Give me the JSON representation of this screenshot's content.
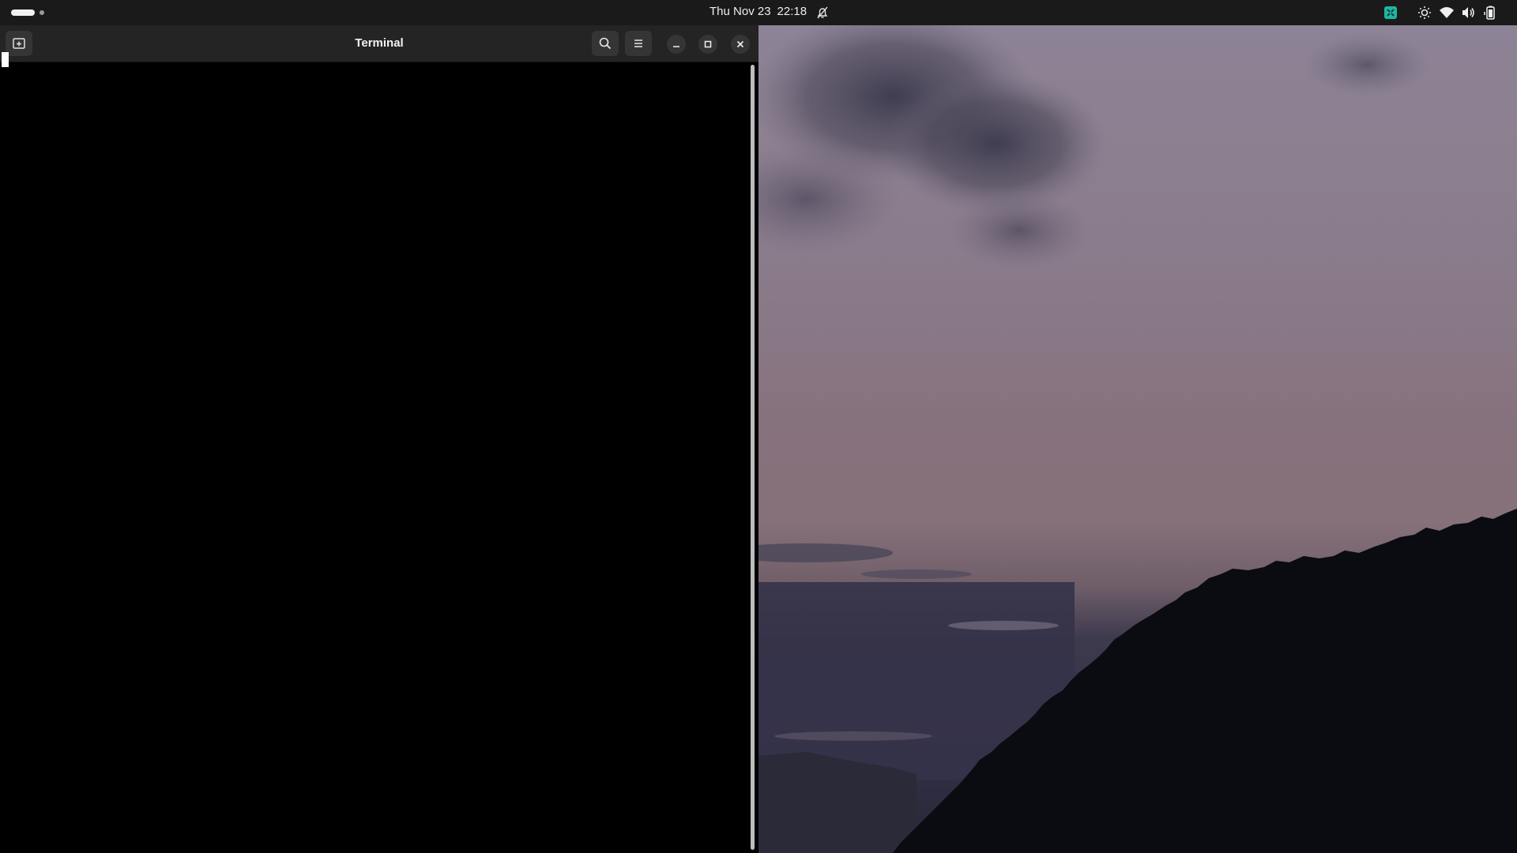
{
  "topbar": {
    "date": "Thu Nov 23",
    "time": "22:18",
    "icons": {
      "activities": "workspace-indicator-icon",
      "notifications": "do-not-disturb-icon",
      "extension": "puzzle-extension-icon",
      "brightness": "brightness-icon",
      "network": "wifi-icon",
      "volume": "volume-icon",
      "battery": "battery-icon"
    },
    "accent": "#1fb5a3"
  },
  "terminal": {
    "title": "Terminal",
    "buttons": {
      "new_tab": "new-tab-icon",
      "search": "search-icon",
      "menu": "hamburger-menu-icon",
      "minimize": "minimize-icon",
      "maximize": "maximize-icon",
      "close": "close-icon"
    },
    "content": ""
  },
  "wallpaper": {
    "description_icon": "crescent-moon-landscape-wallpaper"
  }
}
